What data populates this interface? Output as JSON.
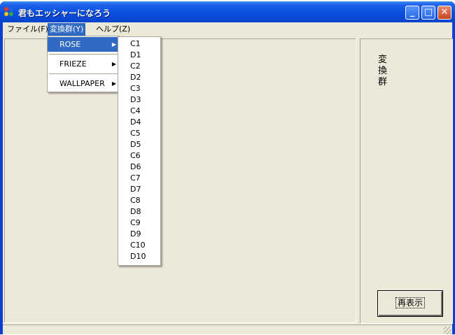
{
  "window": {
    "title": "君もエッシャーになろう",
    "controls": {
      "minimize": "_",
      "maximize": "□",
      "close": "✕"
    }
  },
  "menubar": {
    "items": [
      {
        "label": "ファイル(F)"
      },
      {
        "label": "変換群(Y)"
      },
      {
        "label": "ヘルプ(Z)"
      }
    ]
  },
  "group_menu": {
    "items": [
      {
        "label": "ROSE"
      },
      {
        "label": "FRIEZE"
      },
      {
        "label": "WALLPAPER"
      }
    ],
    "arrow": "▶"
  },
  "rose_submenu": {
    "items": [
      "C1",
      "D1",
      "C2",
      "D2",
      "C3",
      "D3",
      "C4",
      "D4",
      "C5",
      "D5",
      "C6",
      "D6",
      "C7",
      "D7",
      "C8",
      "D8",
      "C9",
      "D9",
      "C10",
      "D10"
    ]
  },
  "side_panel": {
    "label": "変換群",
    "redisplay_button": "再表示"
  },
  "colors": {
    "title_bar": "#0a4fe0",
    "menu_highlight": "#316ac5",
    "face": "#ece9d8"
  }
}
